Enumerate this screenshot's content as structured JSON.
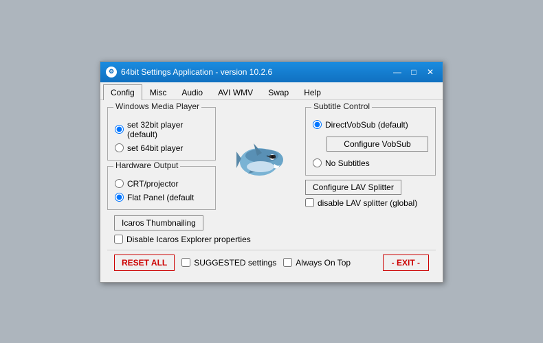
{
  "window": {
    "title": "64bit Settings Application - version 10.2.6",
    "controls": {
      "minimize": "—",
      "maximize": "□",
      "close": "✕"
    }
  },
  "tabs": [
    {
      "label": "Config",
      "active": true
    },
    {
      "label": "Misc"
    },
    {
      "label": "Audio"
    },
    {
      "label": "AVI WMV"
    },
    {
      "label": "Swap"
    },
    {
      "label": "Help"
    }
  ],
  "windows_media_player": {
    "label": "Windows Media Player",
    "options": [
      {
        "label": "set 32bit player (default)",
        "checked": true
      },
      {
        "label": "set 64bit player",
        "checked": false
      }
    ]
  },
  "hardware_output": {
    "label": "Hardware Output",
    "options": [
      {
        "label": "CRT/projector",
        "checked": false
      },
      {
        "label": "Flat Panel (default",
        "checked": true
      }
    ]
  },
  "subtitle_control": {
    "label": "Subtitle Control",
    "options": [
      {
        "label": "DirectVobSub (default)",
        "checked": true
      },
      {
        "label": "No Subtitles",
        "checked": false
      }
    ],
    "configure_btn": "Configure VobSub"
  },
  "lav": {
    "configure_btn": "Configure LAV Splitter",
    "disable_label": "disable LAV splitter (global)",
    "disable_checked": false
  },
  "thumbnailing": {
    "btn_label": "Icaros Thumbnailing",
    "disable_label": "Disable Icaros Explorer properties",
    "disable_checked": false
  },
  "bottom_bar": {
    "reset_label": "RESET ALL",
    "suggested_label": "SUGGESTED settings",
    "suggested_checked": false,
    "always_on_top_label": "Always On Top",
    "always_on_top_checked": false,
    "exit_label": "- EXIT -"
  }
}
